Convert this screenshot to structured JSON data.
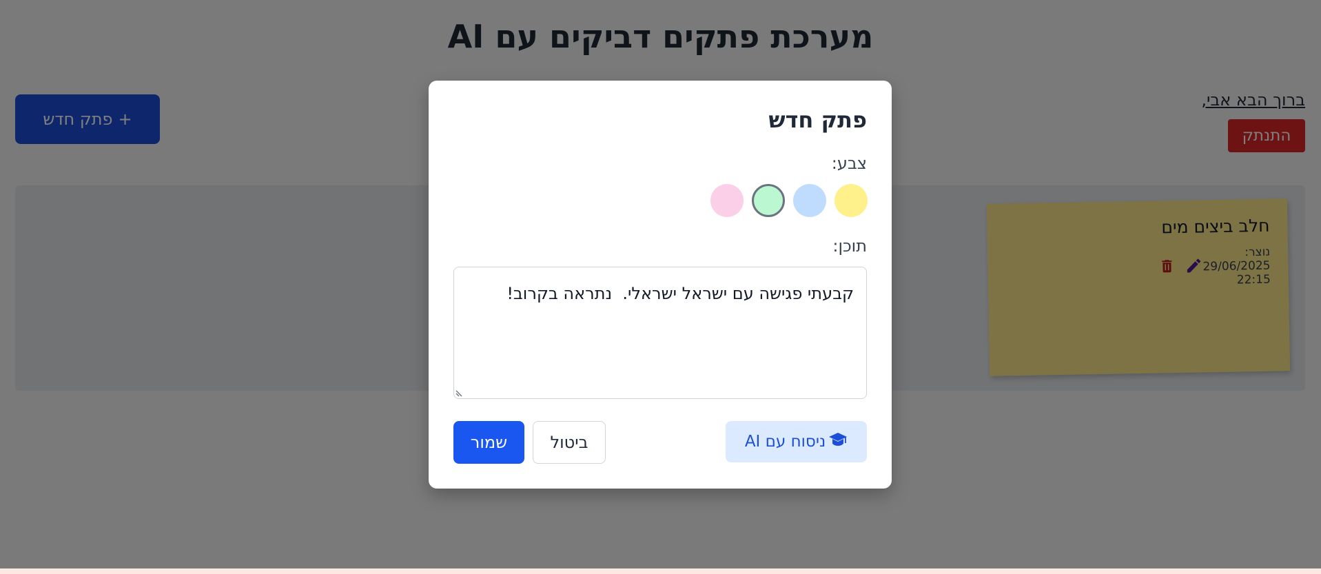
{
  "header": {
    "title": "מערכת פתקים דביקים עם AI",
    "new_note_label": "פתק חדש",
    "new_note_plus": "+",
    "welcome": "ברוך הבא אבי,",
    "logout_label": "התנתק"
  },
  "notes": [
    {
      "title": "חלב ביצים מים",
      "created": "נוצר: 29/06/2025 22:15",
      "color": "#fde68a",
      "icons": [
        "trash-icon",
        "pencil-icon"
      ]
    }
  ],
  "modal": {
    "title": "פתק חדש",
    "color_label": "צבע:",
    "colors": [
      {
        "name": "yellow",
        "hex": "#fef08a",
        "selected": false
      },
      {
        "name": "blue",
        "hex": "#bfdbfe",
        "selected": false
      },
      {
        "name": "green",
        "hex": "#bbf7d0",
        "selected": true
      },
      {
        "name": "pink",
        "hex": "#fbcfe8",
        "selected": false
      }
    ],
    "content_label": "תוכן:",
    "content_value": "קבעתי פגישה עם ישראל ישראלי.  נתראה בקרוב!",
    "ai_label": "ניסוח עם AI",
    "ai_icon": "graduation-cap-icon",
    "cancel_label": "ביטול",
    "save_label": "שמור"
  },
  "colors": {
    "primary": "#1d4ed8",
    "danger": "#dc2626",
    "overlay": "rgba(0,0,0,0.5)"
  }
}
